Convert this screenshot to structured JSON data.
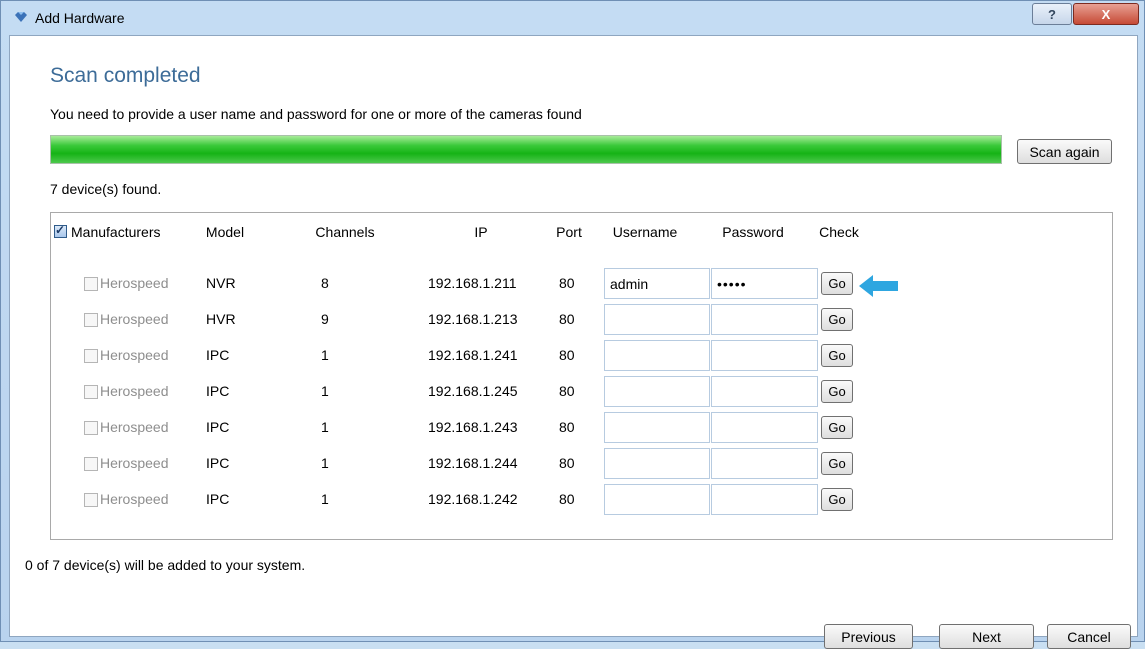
{
  "window": {
    "title": "Add Hardware",
    "help_label": "?",
    "close_label": "X"
  },
  "dialog": {
    "heading": "Scan completed",
    "subtitle": "You need to provide a user name and password for one or more of the cameras found",
    "progress": 1.0,
    "scan_again_label": "Scan again",
    "found_text": "7 device(s) found.",
    "added_text": "0 of 7 device(s) will be added to your system."
  },
  "table": {
    "headers": {
      "manufacturers": "Manufacturers",
      "model": "Model",
      "channels": "Channels",
      "ip": "IP",
      "port": "Port",
      "username": "Username",
      "password": "Password",
      "check": "Check"
    },
    "header_checked": true,
    "go_label": "Go",
    "rows": [
      {
        "manufacturer": "Herospeed",
        "model": "NVR",
        "channels": "8",
        "ip": "192.168.1.211",
        "port": "80",
        "username": "admin",
        "password": "•••••",
        "checked": false
      },
      {
        "manufacturer": "Herospeed",
        "model": "HVR",
        "channels": "9",
        "ip": "192.168.1.213",
        "port": "80",
        "username": "",
        "password": "",
        "checked": false
      },
      {
        "manufacturer": "Herospeed",
        "model": "IPC",
        "channels": "1",
        "ip": "192.168.1.241",
        "port": "80",
        "username": "",
        "password": "",
        "checked": false
      },
      {
        "manufacturer": "Herospeed",
        "model": "IPC",
        "channels": "1",
        "ip": "192.168.1.245",
        "port": "80",
        "username": "",
        "password": "",
        "checked": false
      },
      {
        "manufacturer": "Herospeed",
        "model": "IPC",
        "channels": "1",
        "ip": "192.168.1.243",
        "port": "80",
        "username": "",
        "password": "",
        "checked": false
      },
      {
        "manufacturer": "Herospeed",
        "model": "IPC",
        "channels": "1",
        "ip": "192.168.1.244",
        "port": "80",
        "username": "",
        "password": "",
        "checked": false
      },
      {
        "manufacturer": "Herospeed",
        "model": "IPC",
        "channels": "1",
        "ip": "192.168.1.242",
        "port": "80",
        "username": "",
        "password": "",
        "checked": false
      }
    ]
  },
  "footer": {
    "previous_label": "Previous",
    "next_label": "Next",
    "cancel_label": "Cancel"
  },
  "colors": {
    "heading": "#3d6c98",
    "progress_green": "#16b316",
    "arrow_blue": "#2ea6e0"
  },
  "icons": {
    "app": "diamond-icon",
    "pointer": "arrow-left-icon"
  }
}
